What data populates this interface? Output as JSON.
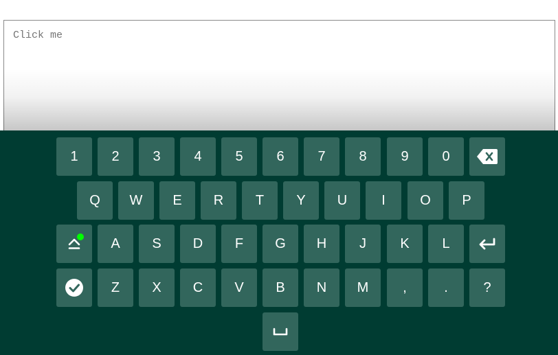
{
  "input": {
    "placeholder": "Click me"
  },
  "keyboard": {
    "rows": [
      [
        "1",
        "2",
        "3",
        "4",
        "5",
        "6",
        "7",
        "8",
        "9",
        "0"
      ],
      [
        "Q",
        "W",
        "E",
        "R",
        "T",
        "Y",
        "U",
        "I",
        "O",
        "P"
      ],
      [
        "A",
        "S",
        "D",
        "F",
        "G",
        "H",
        "J",
        "K",
        "L"
      ],
      [
        "Z",
        "X",
        "C",
        "V",
        "B",
        "N",
        "M",
        ",",
        ".",
        "?"
      ]
    ],
    "special_icons": {
      "backspace": "backspace-icon",
      "shift": "shift-icon",
      "enter": "enter-icon",
      "done": "checkmark-icon",
      "space": "space-icon"
    },
    "colors": {
      "background": "#003c32",
      "key": "#32665c",
      "key_text": "#ffffff",
      "shift_indicator": "#00ff00"
    }
  }
}
